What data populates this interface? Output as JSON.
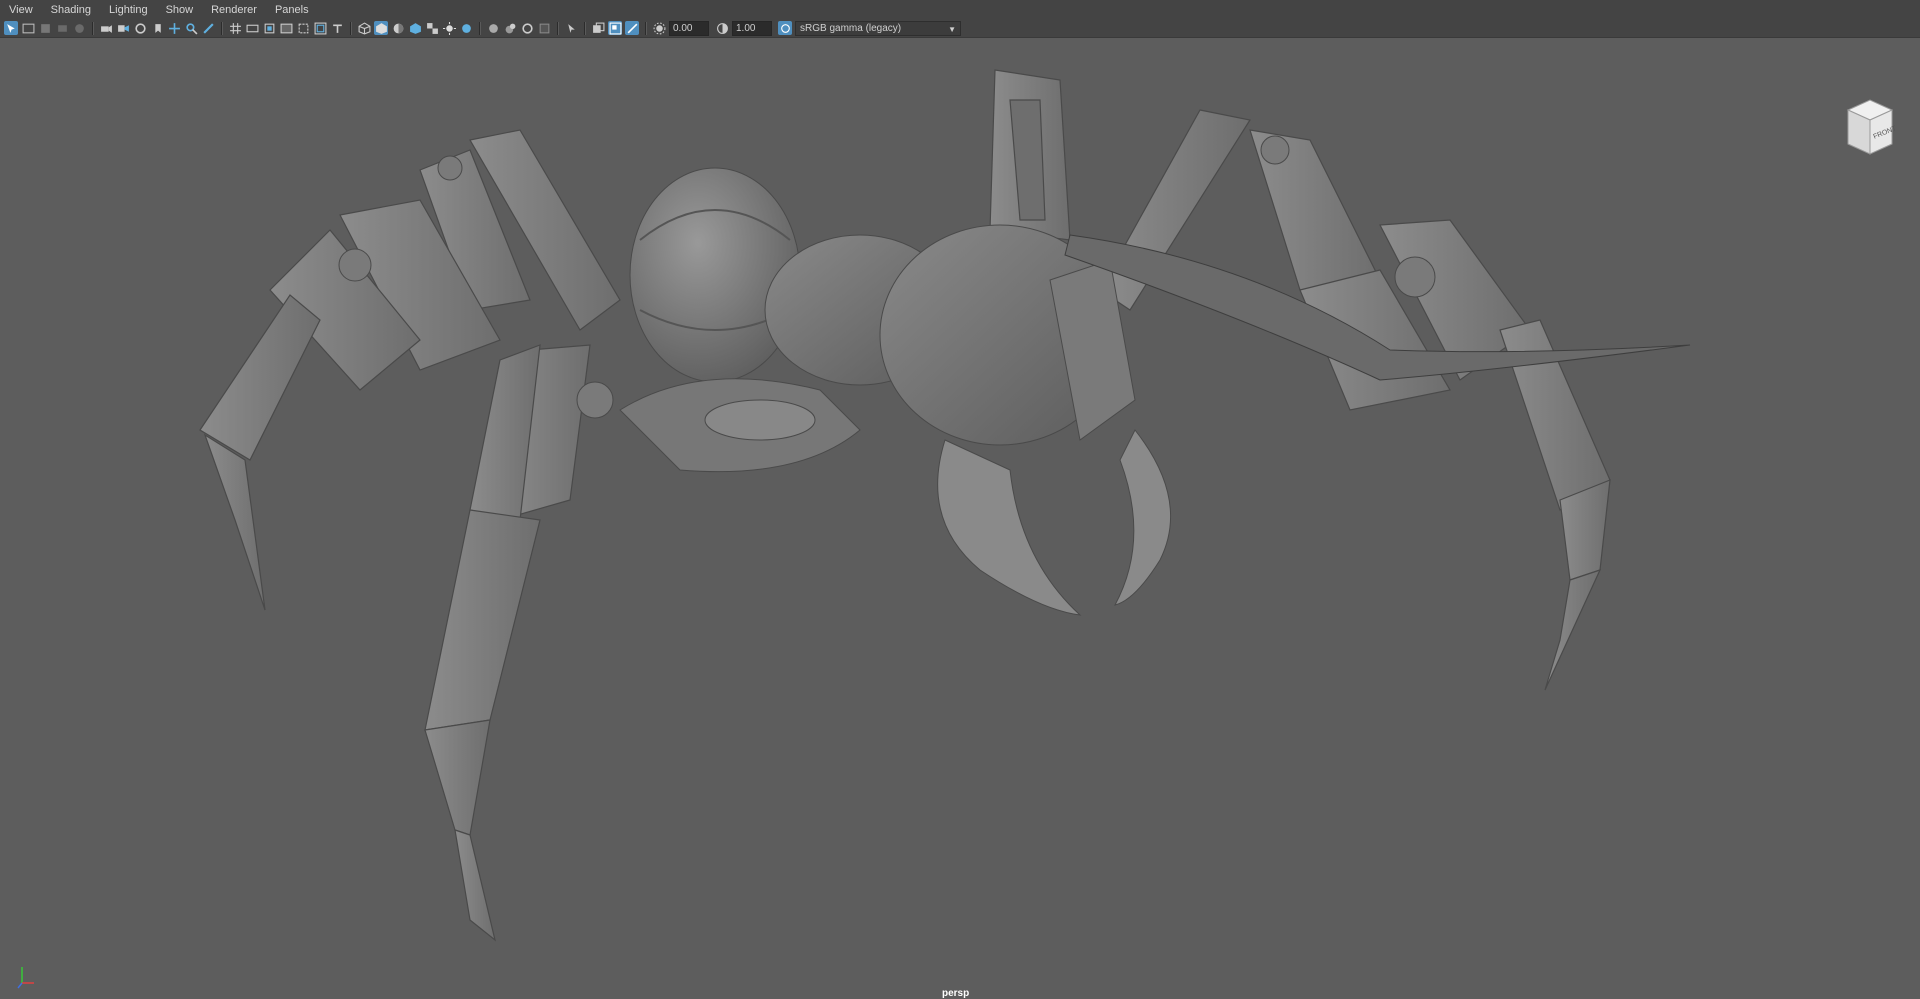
{
  "menubar": {
    "items": [
      "View",
      "Shading",
      "Lighting",
      "Show",
      "Renderer",
      "Panels"
    ]
  },
  "toolbar": {
    "exposure_value": "0.00",
    "gamma_value": "1.00",
    "color_space": "sRGB gamma (legacy)",
    "icons": [
      "select-camera-icon",
      "camera-attributes-icon",
      "bookmark-icon",
      "image-plane-icon",
      "2d-pan-zoom-icon",
      "grid-icon",
      "film-gate-icon",
      "resolution-gate-icon",
      "gate-mask-icon",
      "field-chart-icon",
      "safe-action-icon",
      "wireframe-icon",
      "smooth-shade-icon",
      "use-default-material-icon",
      "textured-icon",
      "lights-icon",
      "shadows-icon",
      "xray-icon",
      "xray-active-icon",
      "xray-joints-icon",
      "isolate-select-icon",
      "hud-icon",
      "exposure-icon",
      "gamma-icon"
    ]
  },
  "viewport": {
    "camera": "persp",
    "viewcube_face": "FRONT",
    "background_color": "#5d5d5d",
    "accent_color": "#4f8fbf"
  },
  "model": {
    "name": "mechanical spider",
    "shading": "default gray"
  }
}
